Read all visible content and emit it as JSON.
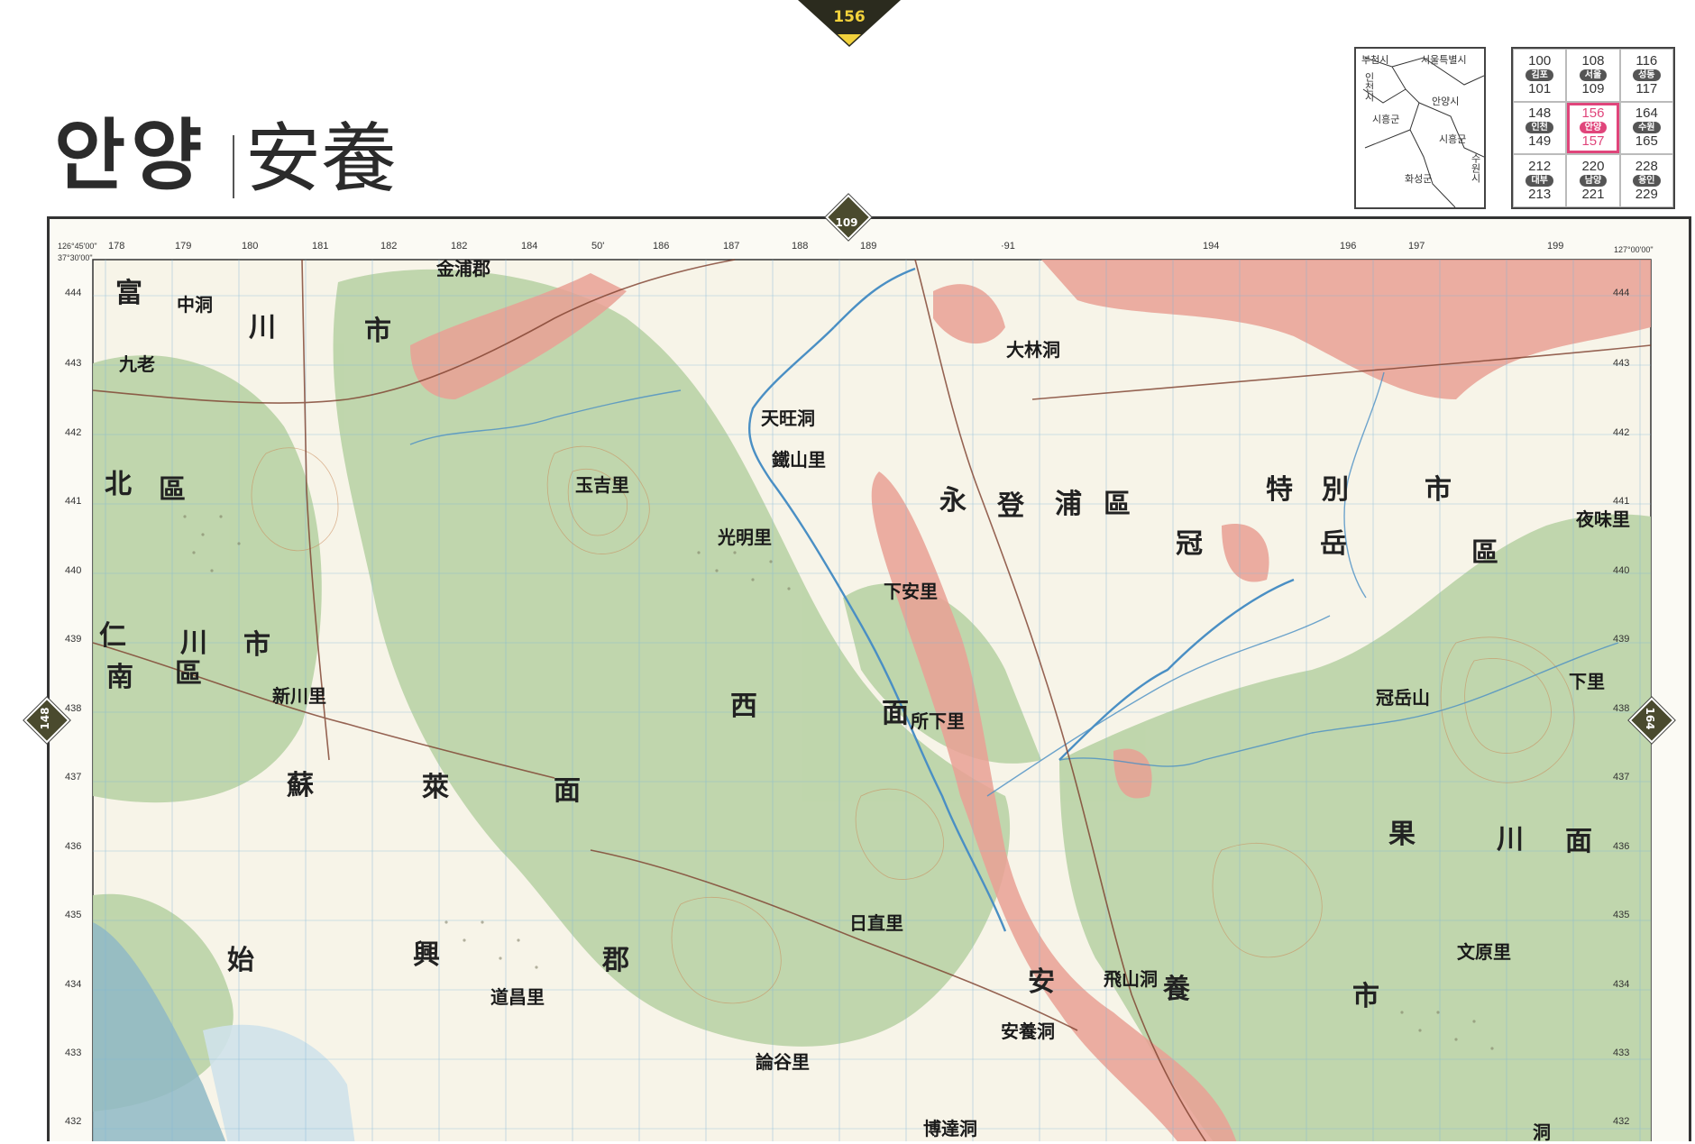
{
  "page": {
    "number": "156"
  },
  "title": {
    "korean": "안양",
    "hanja": "安養"
  },
  "inset_map": {
    "labels": [
      "부천시",
      "서울특별시",
      "인천시",
      "안양시",
      "시흥군",
      "시흥군",
      "화성군",
      "수원시"
    ]
  },
  "index_grid": {
    "cells": [
      {
        "top": "100",
        "label": "김포",
        "bottom": "101",
        "current": false
      },
      {
        "top": "108",
        "label": "서울",
        "bottom": "109",
        "current": false
      },
      {
        "top": "116",
        "label": "성동",
        "bottom": "117",
        "current": false
      },
      {
        "top": "148",
        "label": "인천",
        "bottom": "149",
        "current": false
      },
      {
        "top": "156",
        "label": "안양",
        "bottom": "157",
        "current": true
      },
      {
        "top": "164",
        "label": "수원",
        "bottom": "165",
        "current": false
      },
      {
        "top": "212",
        "label": "대부",
        "bottom": "213",
        "current": false
      },
      {
        "top": "220",
        "label": "남양",
        "bottom": "221",
        "current": false
      },
      {
        "top": "228",
        "label": "용인",
        "bottom": "229",
        "current": false
      }
    ]
  },
  "navigation": {
    "north": "109",
    "west": "148",
    "east": "164"
  },
  "map": {
    "corners": {
      "top_left": "126°45'00\"",
      "lat_top": "37°30'00\"",
      "top_right": "127°00'00\""
    },
    "top_ticks": [
      "178",
      "179",
      "180",
      "181",
      "182",
      "182",
      "184",
      "50'",
      "186",
      "187",
      "188",
      "189",
      "·91",
      "194",
      "196",
      "197",
      "199"
    ],
    "left_ticks": [
      "444",
      "443",
      "442",
      "441",
      "440",
      "439",
      "438",
      "437",
      "436",
      "435",
      "434",
      "433",
      "432"
    ],
    "right_ticks": [
      "444",
      "443",
      "442",
      "441",
      "440",
      "439",
      "438",
      "437",
      "436",
      "435",
      "434",
      "433",
      "432"
    ],
    "places": [
      "金浦郡",
      "富",
      "川",
      "市",
      "中洞",
      "九老",
      "北",
      "區",
      "仁",
      "川",
      "市",
      "南",
      "區",
      "蘇",
      "萊",
      "始",
      "興",
      "郡",
      "面",
      "西",
      "面",
      "安",
      "養",
      "市",
      "光明里",
      "下安里",
      "鐵山里",
      "玉吉里",
      "天旺洞",
      "大林洞",
      "永",
      "登",
      "浦",
      "區",
      "冠",
      "岳",
      "區",
      "果",
      "川",
      "面",
      "冠岳山",
      "下里",
      "文原里",
      "安養洞",
      "道昌里",
      "論谷里",
      "博達洞",
      "飛山洞",
      "所下里",
      "日直里",
      "新川里",
      "夜味里",
      "特",
      "別",
      "市",
      "洞"
    ]
  },
  "colors": {
    "forest": "#b9d3a6",
    "urban": "#e9a094",
    "water": "#4a8fc4",
    "contour": "#c98a5a",
    "grid": "#7fb6d8",
    "accent": "#e0457b"
  }
}
